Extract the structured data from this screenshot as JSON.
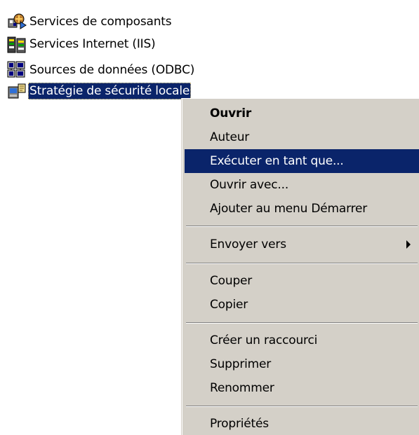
{
  "file_list": {
    "items": [
      {
        "label": "Services de composants",
        "icon": "component-services-icon"
      },
      {
        "label": "Services Internet (IIS)",
        "icon": "iis-icon"
      },
      {
        "label": "Sources de données (ODBC)",
        "icon": "odbc-icon"
      },
      {
        "label": "Stratégie de sécurité locale",
        "icon": "local-security-policy-icon",
        "selected": true
      }
    ]
  },
  "context_menu": {
    "items": [
      {
        "label": "Ouvrir",
        "default": true
      },
      {
        "label": "Auteur"
      },
      {
        "label": "Exécuter en tant que...",
        "highlighted": true
      },
      {
        "label": "Ouvrir avec..."
      },
      {
        "label": "Ajouter au menu Démarrer"
      },
      {
        "label": "Envoyer vers",
        "submenu": true
      },
      {
        "label": "Couper"
      },
      {
        "label": "Copier"
      },
      {
        "label": "Créer un raccourci"
      },
      {
        "label": "Supprimer"
      },
      {
        "label": "Renommer"
      },
      {
        "label": "Propriétés"
      }
    ]
  },
  "colors": {
    "menu_background": "#d4d0c8",
    "selection": "#0a246a",
    "selection_text": "#ffffff"
  }
}
